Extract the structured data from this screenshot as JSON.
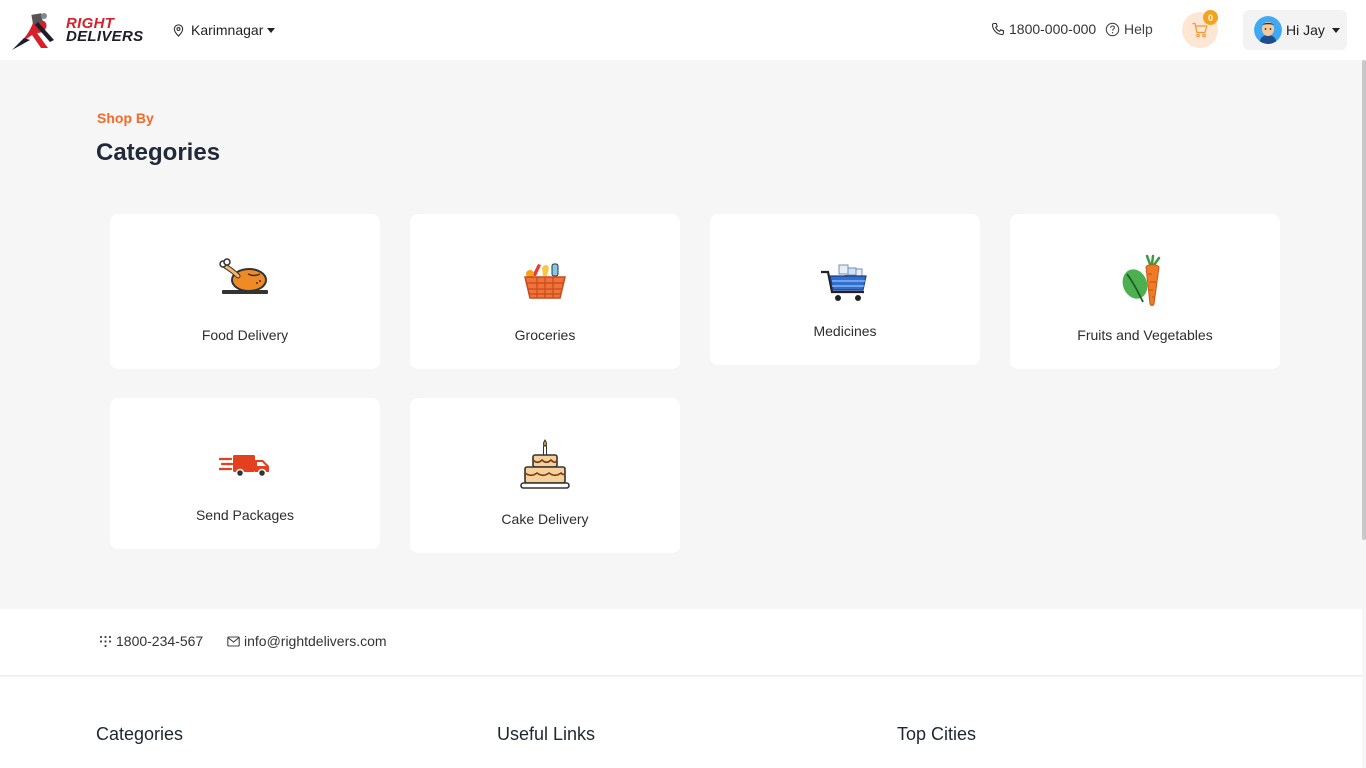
{
  "header": {
    "logo": {
      "line1": "RIGHT",
      "line2": "DELIVERS"
    },
    "location": "Karimnagar",
    "phone": "1800-000-000",
    "help": "Help",
    "cart_count": "0",
    "user_greeting": "Hi Jay"
  },
  "section": {
    "eyebrow": "Shop By",
    "title": "Categories"
  },
  "categories": [
    {
      "label": "Food Delivery",
      "icon": "roast-chicken-icon"
    },
    {
      "label": "Groceries",
      "icon": "grocery-basket-icon"
    },
    {
      "label": "Medicines",
      "icon": "medicine-cart-icon"
    },
    {
      "label": "Fruits and Vegetables",
      "icon": "vegetables-icon"
    },
    {
      "label": "Send Packages",
      "icon": "delivery-truck-icon"
    },
    {
      "label": "Cake Delivery",
      "icon": "birthday-cake-icon"
    }
  ],
  "contact": {
    "phone": "1800-234-567",
    "email": "info@rightdelivers.com"
  },
  "footer": {
    "columns": [
      "Categories",
      "Useful Links",
      "Top Cities"
    ]
  },
  "colors": {
    "accent": "#f26a27",
    "brand_red": "#d8202a",
    "background": "#f6f6f6"
  }
}
